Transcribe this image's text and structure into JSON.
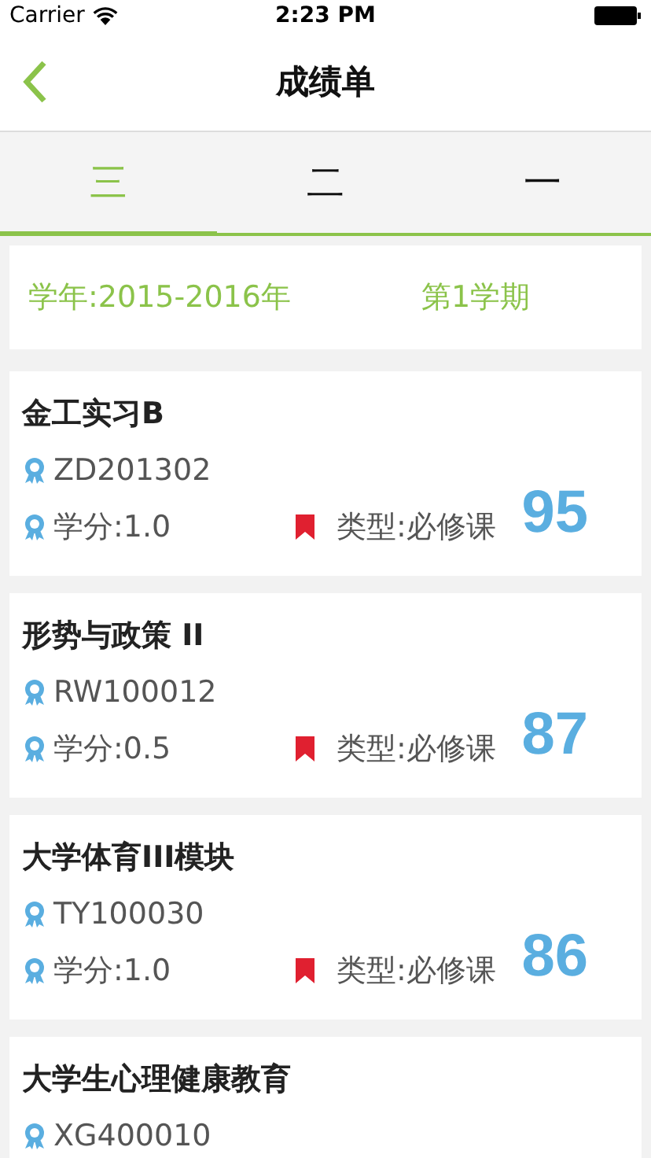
{
  "status_bar": {
    "carrier": "Carrier",
    "time": "2:23 PM"
  },
  "nav": {
    "title": "成绩单"
  },
  "tabs": [
    {
      "label": "三",
      "selected": true
    },
    {
      "label": "二",
      "selected": false
    },
    {
      "label": "一",
      "selected": false
    }
  ],
  "term": {
    "year": "学年:2015-2016年",
    "semester": "第1学期"
  },
  "courses": [
    {
      "name": "金工实习B",
      "code": "ZD201302",
      "credit": "学分:1.0",
      "type": "类型:必修课",
      "score": "95"
    },
    {
      "name": "形势与政策 II",
      "code": "RW100012",
      "credit": "学分:0.5",
      "type": "类型:必修课",
      "score": "87"
    },
    {
      "name": "大学体育III模块",
      "code": "TY100030",
      "credit": "学分:1.0",
      "type": "类型:必修课",
      "score": "86"
    },
    {
      "name": "大学生心理健康教育",
      "code": "XG400010"
    }
  ]
}
